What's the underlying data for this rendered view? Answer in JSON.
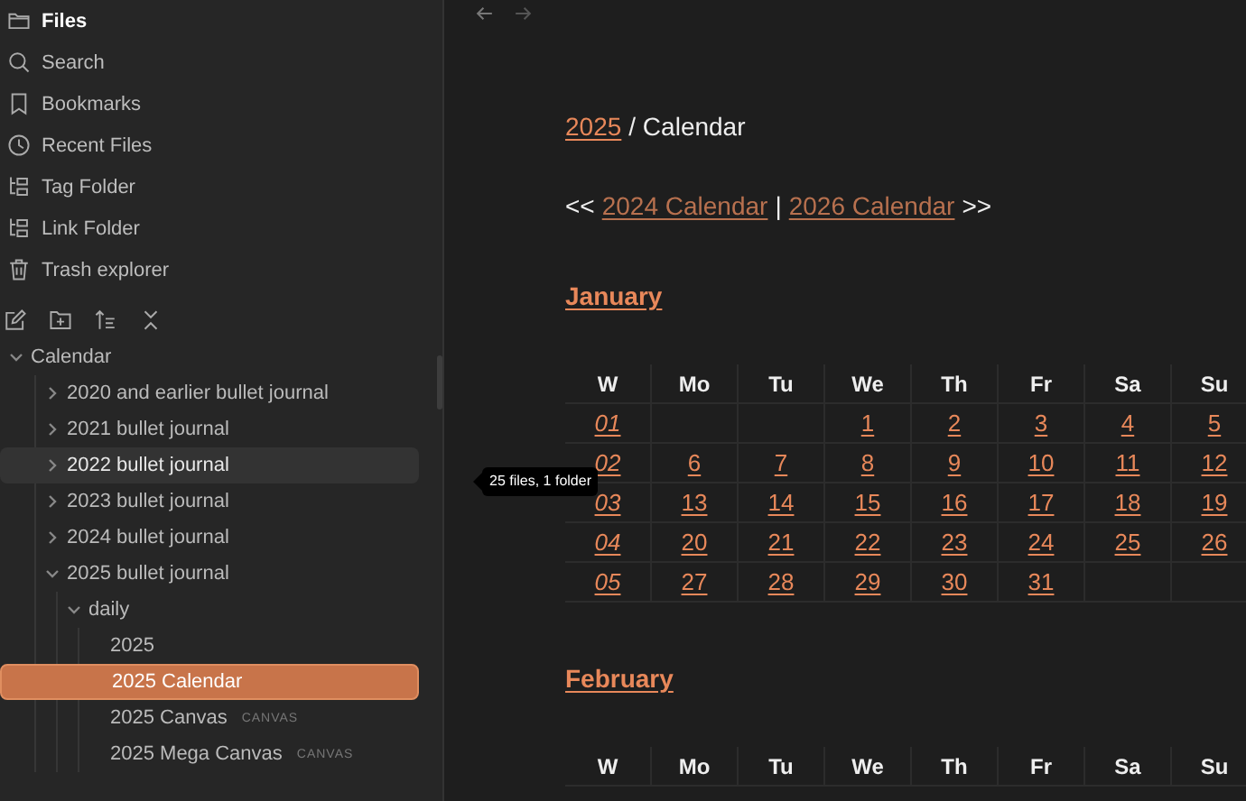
{
  "sidebar": {
    "nav": [
      {
        "label": "Files",
        "selected": true
      },
      {
        "label": "Search",
        "selected": false
      },
      {
        "label": "Bookmarks",
        "selected": false
      },
      {
        "label": "Recent Files",
        "selected": false
      },
      {
        "label": "Tag Folder",
        "selected": false
      },
      {
        "label": "Link Folder",
        "selected": false
      },
      {
        "label": "Trash explorer",
        "selected": false
      }
    ],
    "tree": [
      {
        "label": "Calendar",
        "expanded": true,
        "hovered": false,
        "selected": false,
        "children": [
          {
            "label": "2020 and earlier bullet journal",
            "expanded": false,
            "hovered": false,
            "selected": false
          },
          {
            "label": "2021 bullet journal",
            "expanded": false,
            "hovered": false,
            "selected": false
          },
          {
            "label": "2022 bullet journal",
            "expanded": false,
            "hovered": true,
            "selected": false
          },
          {
            "label": "2023 bullet journal",
            "expanded": false,
            "hovered": false,
            "selected": false
          },
          {
            "label": "2024 bullet journal",
            "expanded": false,
            "hovered": false,
            "selected": false
          },
          {
            "label": "2025 bullet journal",
            "expanded": true,
            "hovered": false,
            "selected": false,
            "children": [
              {
                "label": "daily",
                "expanded": true,
                "hovered": false,
                "selected": false,
                "children": [
                  {
                    "label": "2025",
                    "hovered": false,
                    "selected": false
                  },
                  {
                    "label": "2025 Calendar",
                    "hovered": false,
                    "selected": true
                  },
                  {
                    "label": "2025 Canvas",
                    "tag": "CANVAS",
                    "hovered": false,
                    "selected": false
                  },
                  {
                    "label": "2025 Mega Canvas",
                    "tag": "CANVAS",
                    "hovered": false,
                    "selected": false
                  }
                ]
              }
            ]
          }
        ]
      }
    ],
    "tooltip": "25 files, 1 folder"
  },
  "note": {
    "breadcrumb": {
      "link": "2025",
      "text": "/ Calendar"
    },
    "pager": {
      "prev_arrows": "<<",
      "prev": "2024 Calendar",
      "separator": "|",
      "next": "2026 Calendar",
      "next_arrows": ">>"
    },
    "months": [
      {
        "name": "January",
        "columns": [
          "W",
          "Mo",
          "Tu",
          "We",
          "Th",
          "Fr",
          "Sa",
          "Su"
        ],
        "rows": [
          [
            "01",
            "",
            "",
            "1",
            "2",
            "3",
            "4",
            "5"
          ],
          [
            "02",
            "6",
            "7",
            "8",
            "9",
            "10",
            "11",
            "12"
          ],
          [
            "03",
            "13",
            "14",
            "15",
            "16",
            "17",
            "18",
            "19"
          ],
          [
            "04",
            "20",
            "21",
            "22",
            "23",
            "24",
            "25",
            "26"
          ],
          [
            "05",
            "27",
            "28",
            "29",
            "30",
            "31",
            "",
            ""
          ]
        ]
      },
      {
        "name": "February",
        "columns": [
          "W",
          "Mo",
          "Tu",
          "We",
          "Th",
          "Fr",
          "Sa",
          "Su"
        ]
      }
    ]
  }
}
